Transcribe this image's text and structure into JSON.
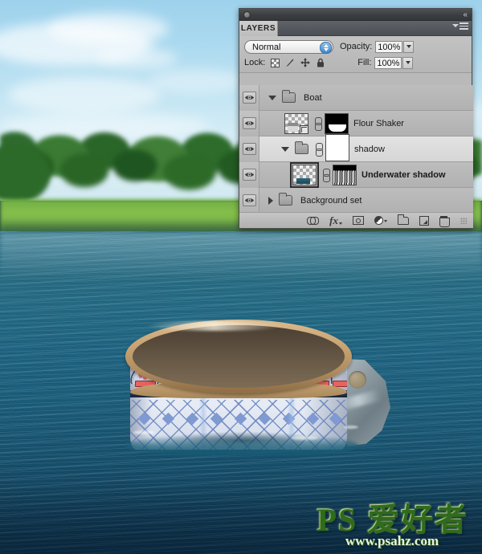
{
  "photo": {
    "description": "Lake scene with decorated flour shaker tin floating like a boat",
    "sky_color": "#a8d8ef",
    "water_color": "#1f6380",
    "grass_color": "#7ab348",
    "tree_color": "#2f6b2e"
  },
  "watermark": {
    "main": "PS 爱好者",
    "url": "www.psahz.com",
    "color": "#8cc63f"
  },
  "panel": {
    "titlebar": {
      "collapse_icon": "«"
    },
    "tab": {
      "label": "LAYERS",
      "menu_icon": "panel-menu-icon"
    },
    "controls": {
      "blend_mode": "Normal",
      "opacity_label": "Opacity:",
      "opacity_value": "100%",
      "fill_label": "Fill:",
      "fill_value": "100%",
      "lock_label": "Lock:",
      "lock_icons": [
        "lock-transparent-pixels-icon",
        "lock-image-pixels-icon",
        "lock-position-icon",
        "lock-all-icon"
      ]
    },
    "rows": [
      {
        "name": "Boat",
        "type": "group",
        "visible": true,
        "expanded": true,
        "selected": false,
        "indent": 0,
        "bold": false,
        "has_thumb": false,
        "has_mask": false,
        "has_link": false
      },
      {
        "name": "Flour Shaker",
        "type": "layer",
        "visible": true,
        "expanded": null,
        "selected": false,
        "indent": 1,
        "bold": false,
        "has_thumb": true,
        "thumb_kind": "smart-object",
        "has_mask": true,
        "mask_kind": "black-with-white-shape",
        "has_link": true
      },
      {
        "name": "shadow",
        "type": "group",
        "visible": true,
        "expanded": true,
        "selected": true,
        "indent": 1,
        "bold": false,
        "has_thumb": false,
        "has_mask": true,
        "mask_kind": "white",
        "has_link": true
      },
      {
        "name": "Underwater shadow",
        "type": "layer",
        "visible": true,
        "expanded": null,
        "selected": false,
        "indent": 2,
        "bold": true,
        "has_thumb": true,
        "thumb_kind": "transparent-selected",
        "has_mask": true,
        "mask_kind": "noise",
        "has_link": true
      },
      {
        "name": "Background set",
        "type": "group",
        "visible": true,
        "expanded": false,
        "selected": false,
        "indent": 0,
        "bold": false,
        "has_thumb": false,
        "has_mask": false,
        "has_link": false
      }
    ],
    "bottom_toolbar": [
      {
        "icon": "link-layers-icon",
        "label": ""
      },
      {
        "icon": "layer-styles-fx-icon",
        "label": "fx"
      },
      {
        "icon": "add-layer-mask-icon",
        "label": ""
      },
      {
        "icon": "adjustment-layer-icon",
        "label": ""
      },
      {
        "icon": "new-group-icon",
        "label": ""
      },
      {
        "icon": "new-layer-icon",
        "label": ""
      },
      {
        "icon": "delete-layer-icon",
        "label": ""
      }
    ]
  }
}
